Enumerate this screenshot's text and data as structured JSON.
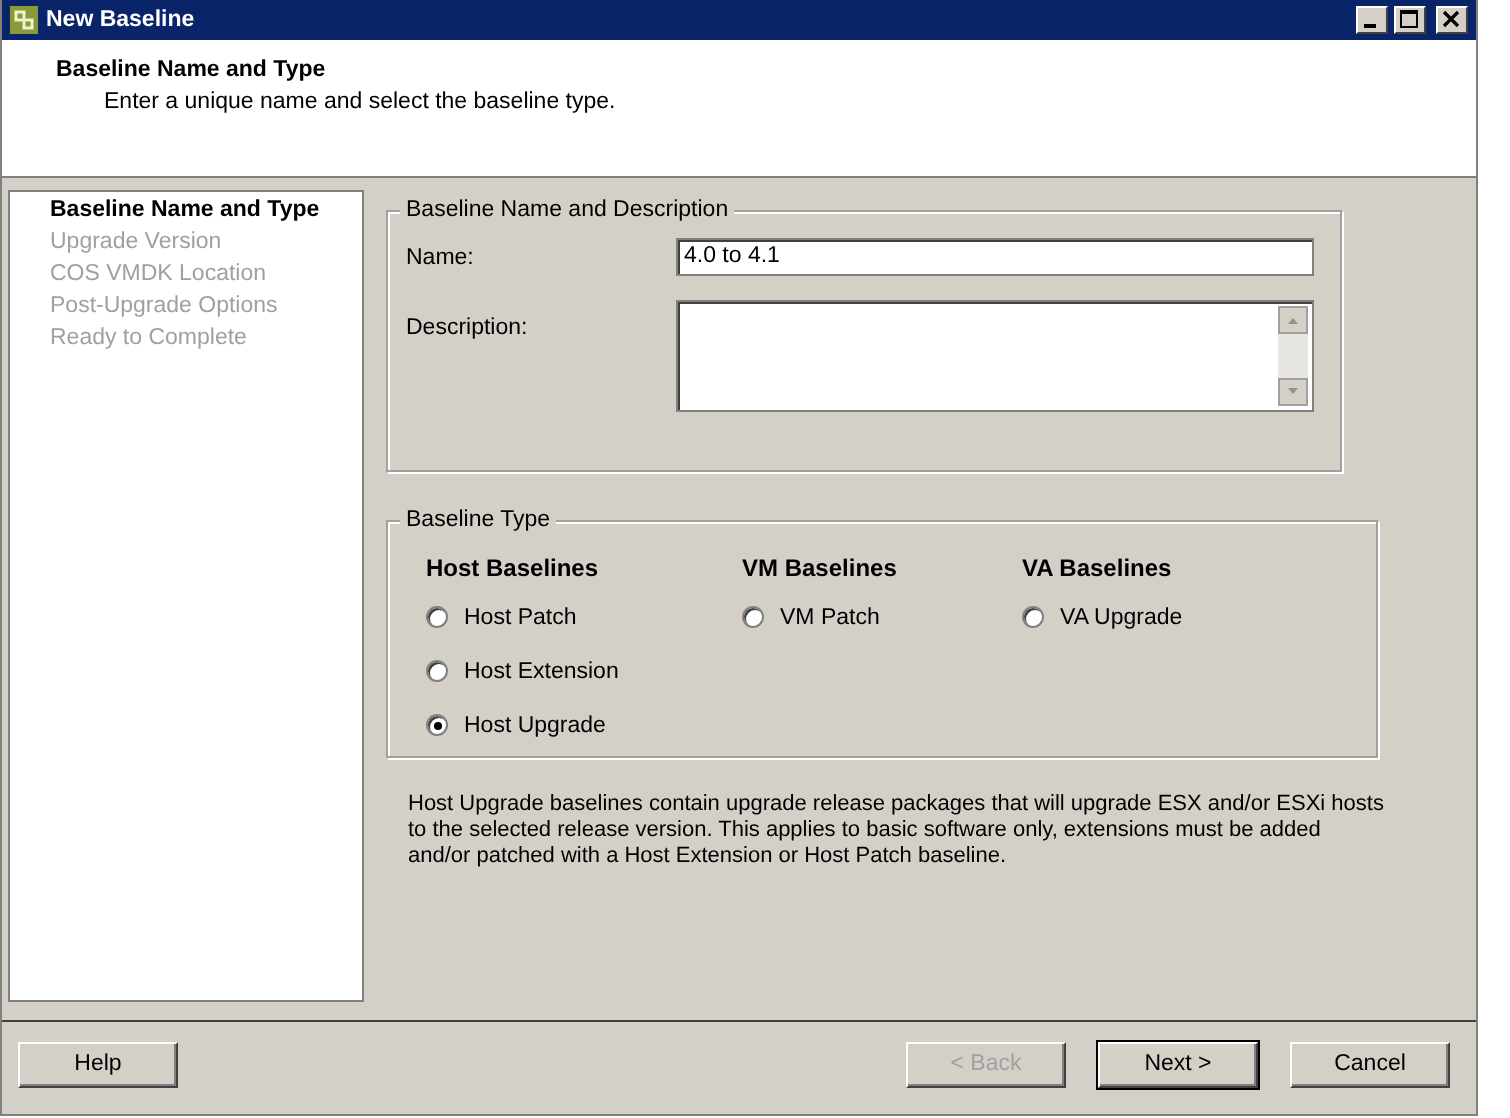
{
  "window": {
    "title": "New Baseline"
  },
  "header": {
    "title": "Baseline Name and Type",
    "subtitle": "Enter a unique name and select the baseline type."
  },
  "steps": [
    {
      "label": "Baseline Name and Type",
      "selected": true
    },
    {
      "label": "Upgrade Version",
      "selected": false
    },
    {
      "label": "COS VMDK Location",
      "selected": false
    },
    {
      "label": "Post-Upgrade Options",
      "selected": false
    },
    {
      "label": "Ready to Complete",
      "selected": false
    }
  ],
  "name_group": {
    "title": "Baseline Name and Description",
    "name_label": "Name:",
    "name_value": "4.0 to 4.1",
    "description_label": "Description:"
  },
  "type_group": {
    "title": "Baseline Type",
    "columns": [
      {
        "heading": "Host Baselines",
        "options": [
          {
            "label": "Host Patch",
            "selected": false
          },
          {
            "label": "Host Extension",
            "selected": false
          },
          {
            "label": "Host Upgrade",
            "selected": true
          }
        ]
      },
      {
        "heading": "VM Baselines",
        "options": [
          {
            "label": "VM Patch",
            "selected": false
          }
        ]
      },
      {
        "heading": "VA Baselines",
        "options": [
          {
            "label": "VA Upgrade",
            "selected": false
          }
        ]
      }
    ]
  },
  "info": "Host Upgrade baselines contain upgrade release packages that will upgrade ESX and/or ESXi hosts to the selected release version. This applies to basic software only, extensions must be added and/or patched with a Host Extension or Host Patch baseline.",
  "left_buttons": [
    {
      "label": "Help",
      "disabled": false,
      "focused": false
    }
  ],
  "right_buttons": [
    {
      "label": "< Back",
      "disabled": true,
      "focused": false
    },
    {
      "label": "Next >",
      "disabled": false,
      "focused": true
    },
    {
      "label": "Cancel",
      "disabled": false,
      "focused": false
    }
  ]
}
